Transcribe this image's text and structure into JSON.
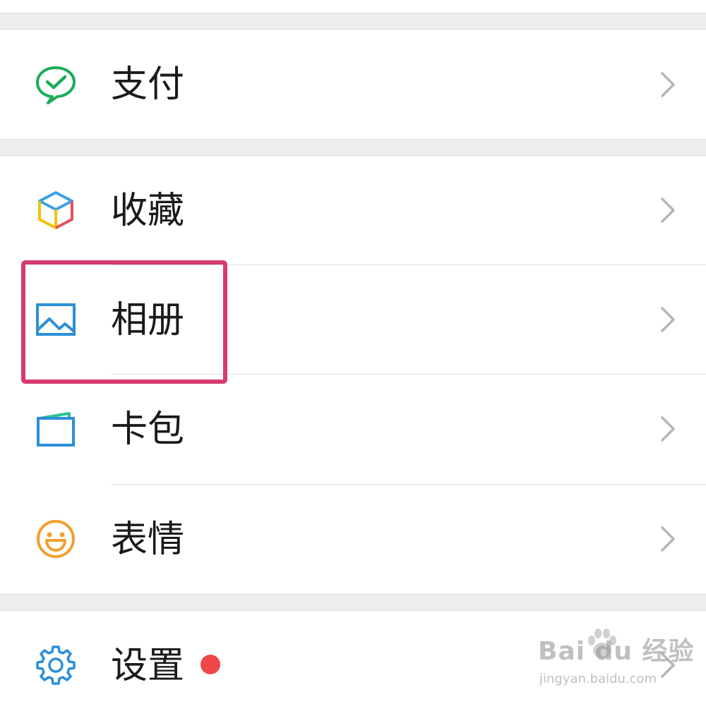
{
  "menu": {
    "pay": {
      "label": "支付",
      "icon": "wechat-pay-icon"
    },
    "favorites": {
      "label": "收藏",
      "icon": "cube-icon"
    },
    "album": {
      "label": "相册",
      "icon": "image-icon"
    },
    "cards": {
      "label": "卡包",
      "icon": "wallet-icon"
    },
    "stickers": {
      "label": "表情",
      "icon": "smiley-icon"
    },
    "settings": {
      "label": "设置",
      "icon": "gear-icon",
      "has_badge": true
    }
  },
  "watermark": {
    "main": "Bai du 经验",
    "sub": "jingyan.baidu.com"
  },
  "colors": {
    "highlight": "#d63a72",
    "badge": "#f04848",
    "pay_green": "#1aad5a",
    "album_blue": "#2d8fd8",
    "sticker_orange": "#f0a030",
    "settings_blue": "#2d8fd8"
  }
}
